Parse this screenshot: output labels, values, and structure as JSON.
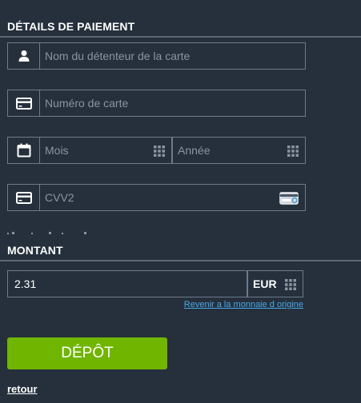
{
  "payment": {
    "title": "DÉTAILS DE PAIEMENT",
    "cardholder_placeholder": "Nom du détenteur de la carte",
    "card_number_placeholder": "Numéro de carte",
    "month_placeholder": "Mois",
    "year_placeholder": "Année",
    "cvv_placeholder": "CVV2"
  },
  "amount": {
    "title": "MONTANT",
    "value": "2.31",
    "currency": "EUR",
    "revert_link": "Revenir a la monnaie d origine"
  },
  "actions": {
    "deposit_label": "DÉPÔT",
    "back_label": "retour"
  },
  "icons": {
    "cardholder": "user-icon",
    "card_number": "credit-card-icon",
    "date": "calendar-icon",
    "cvv": "credit-card-icon",
    "cvv_hint": "card-back-icon",
    "picker": "grid-icon"
  },
  "colors": {
    "background": "#25303c",
    "border": "#6f7b89",
    "placeholder": "#8b95a1",
    "accent_button": "#70b500",
    "link": "#4aa8e8"
  }
}
